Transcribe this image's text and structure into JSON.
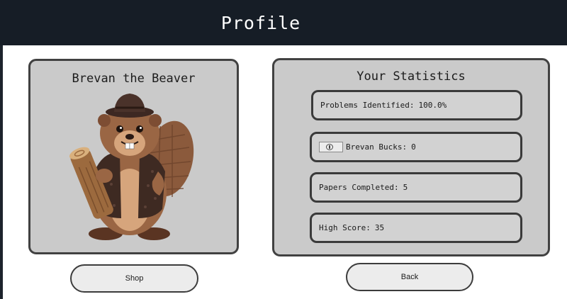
{
  "header": {
    "title": "Profile"
  },
  "character": {
    "name": "Brevan the Beaver"
  },
  "statistics": {
    "title": "Your Statistics",
    "problems_identified": {
      "label": "Problems Identified:",
      "value": "100.0%"
    },
    "brevan_bucks": {
      "label": "Brevan Bucks:",
      "value": "0"
    },
    "papers_completed": {
      "label": "Papers Completed:",
      "value": "5"
    },
    "high_score": {
      "label": "High Score:",
      "value": "35"
    }
  },
  "buttons": {
    "shop": "Shop",
    "back": "Back"
  },
  "colors": {
    "header_bg": "#161d26",
    "panel_bg": "#cacaca",
    "panel_border": "#414141",
    "button_bg": "#ececec"
  },
  "icons": {
    "mascot": "beaver-mascot-illustration",
    "currency": "coin-icon"
  }
}
